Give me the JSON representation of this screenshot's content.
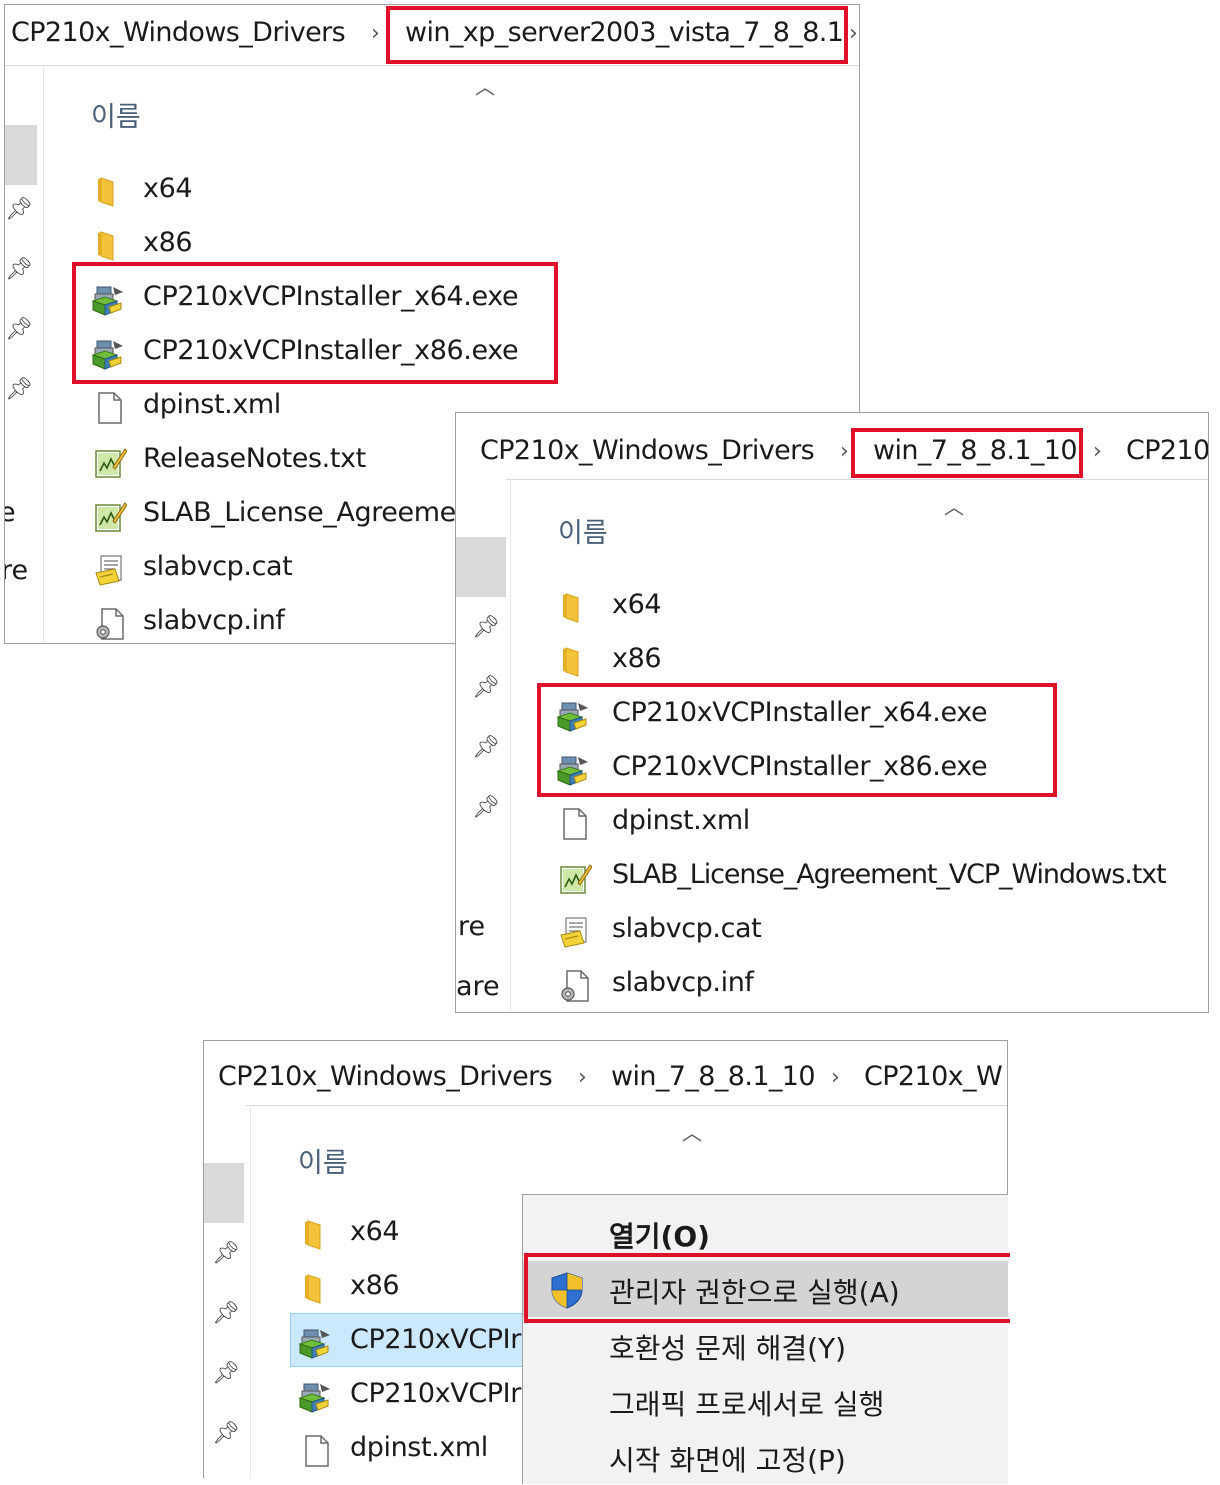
{
  "panel1": {
    "breadcrumb": [
      "CP210x_Windows_Drivers",
      "win_xp_server2003_vista_7_8_8.1"
    ],
    "column_header": "이름",
    "nav_fragments": [
      "e",
      "re"
    ],
    "files": [
      {
        "name": "x64",
        "icon": "folder-icon"
      },
      {
        "name": "x86",
        "icon": "folder-icon"
      },
      {
        "name": "CP210xVCPInstaller_x64.exe",
        "icon": "installer-icon"
      },
      {
        "name": "CP210xVCPInstaller_x86.exe",
        "icon": "installer-icon"
      },
      {
        "name": "dpinst.xml",
        "icon": "document-icon"
      },
      {
        "name": "ReleaseNotes.txt",
        "icon": "text-file-icon"
      },
      {
        "name": "SLAB_License_Agreeme",
        "icon": "text-file-icon"
      },
      {
        "name": "slabvcp.cat",
        "icon": "catalog-icon"
      },
      {
        "name": "slabvcp.inf",
        "icon": "setup-info-icon"
      }
    ]
  },
  "panel2": {
    "breadcrumb": [
      "CP210x_Windows_Drivers",
      "win_7_8_8.1_10",
      "CP210"
    ],
    "column_header": "이름",
    "nav_fragments": [
      "re",
      "are"
    ],
    "files": [
      {
        "name": "x64",
        "icon": "folder-icon"
      },
      {
        "name": "x86",
        "icon": "folder-icon"
      },
      {
        "name": "CP210xVCPInstaller_x64.exe",
        "icon": "installer-icon"
      },
      {
        "name": "CP210xVCPInstaller_x86.exe",
        "icon": "installer-icon"
      },
      {
        "name": "dpinst.xml",
        "icon": "document-icon"
      },
      {
        "name": "SLAB_License_Agreement_VCP_Windows.txt",
        "icon": "text-file-icon"
      },
      {
        "name": "slabvcp.cat",
        "icon": "catalog-icon"
      },
      {
        "name": "slabvcp.inf",
        "icon": "setup-info-icon"
      }
    ]
  },
  "panel3": {
    "breadcrumb": [
      "CP210x_Windows_Drivers",
      "win_7_8_8.1_10",
      "CP210x_W"
    ],
    "column_header": "이름",
    "files": [
      {
        "name": "x64",
        "icon": "folder-icon"
      },
      {
        "name": "x86",
        "icon": "folder-icon"
      },
      {
        "name": "CP210xVCPIr",
        "icon": "installer-icon"
      },
      {
        "name": "CP210xVCPIr",
        "icon": "installer-icon"
      },
      {
        "name": "dpinst.xml",
        "icon": "document-icon"
      }
    ]
  },
  "context_menu": {
    "items": [
      {
        "label": "열기(O)",
        "bold": true
      },
      {
        "label": "관리자 권한으로 실행(A)",
        "icon": "uac-shield-icon"
      },
      {
        "label": "호환성 문제 해결(Y)"
      },
      {
        "label": "그래픽 프로세서로 실행"
      },
      {
        "label": "시작 화면에 고정(P)"
      }
    ]
  },
  "colors": {
    "highlight": "#e0102a",
    "selection": "#cce8ff",
    "menu_background": "#f2f2f2",
    "menu_hover": "#d4d4d4"
  }
}
